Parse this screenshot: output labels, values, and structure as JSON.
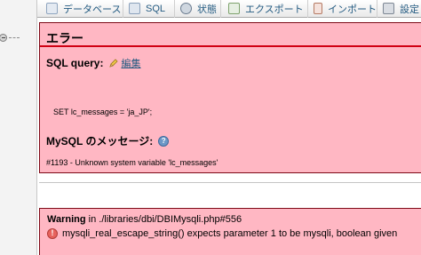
{
  "menubar": {
    "tabs": [
      {
        "label": "データベース",
        "icon": "database-icon"
      },
      {
        "label": "SQL",
        "icon": "sql-icon"
      },
      {
        "label": "状態",
        "icon": "status-icon"
      },
      {
        "label": "エクスポート",
        "icon": "export-icon"
      },
      {
        "label": "インポート",
        "icon": "import-icon"
      },
      {
        "label": "設定",
        "icon": "settings-icon"
      }
    ]
  },
  "error": {
    "title": "エラー",
    "sql_query_label": "SQL query:",
    "edit_label": "編集",
    "sql_text": "SET lc_messages = 'ja_JP';",
    "mysql_message_label": "MySQL のメッセージ:",
    "message": "#1193 - Unknown system variable 'lc_messages'"
  },
  "warning": {
    "label": "Warning",
    "location": " in ./libraries/dbi/DBIMysqli.php#556",
    "message": "mysqli_real_escape_string() expects parameter 1 to be mysqli, boolean given"
  },
  "colors": {
    "error_background": "#ffb7c3",
    "error_border": "#7e0a17",
    "error_rule": "#d00013",
    "link": "#235a81"
  }
}
